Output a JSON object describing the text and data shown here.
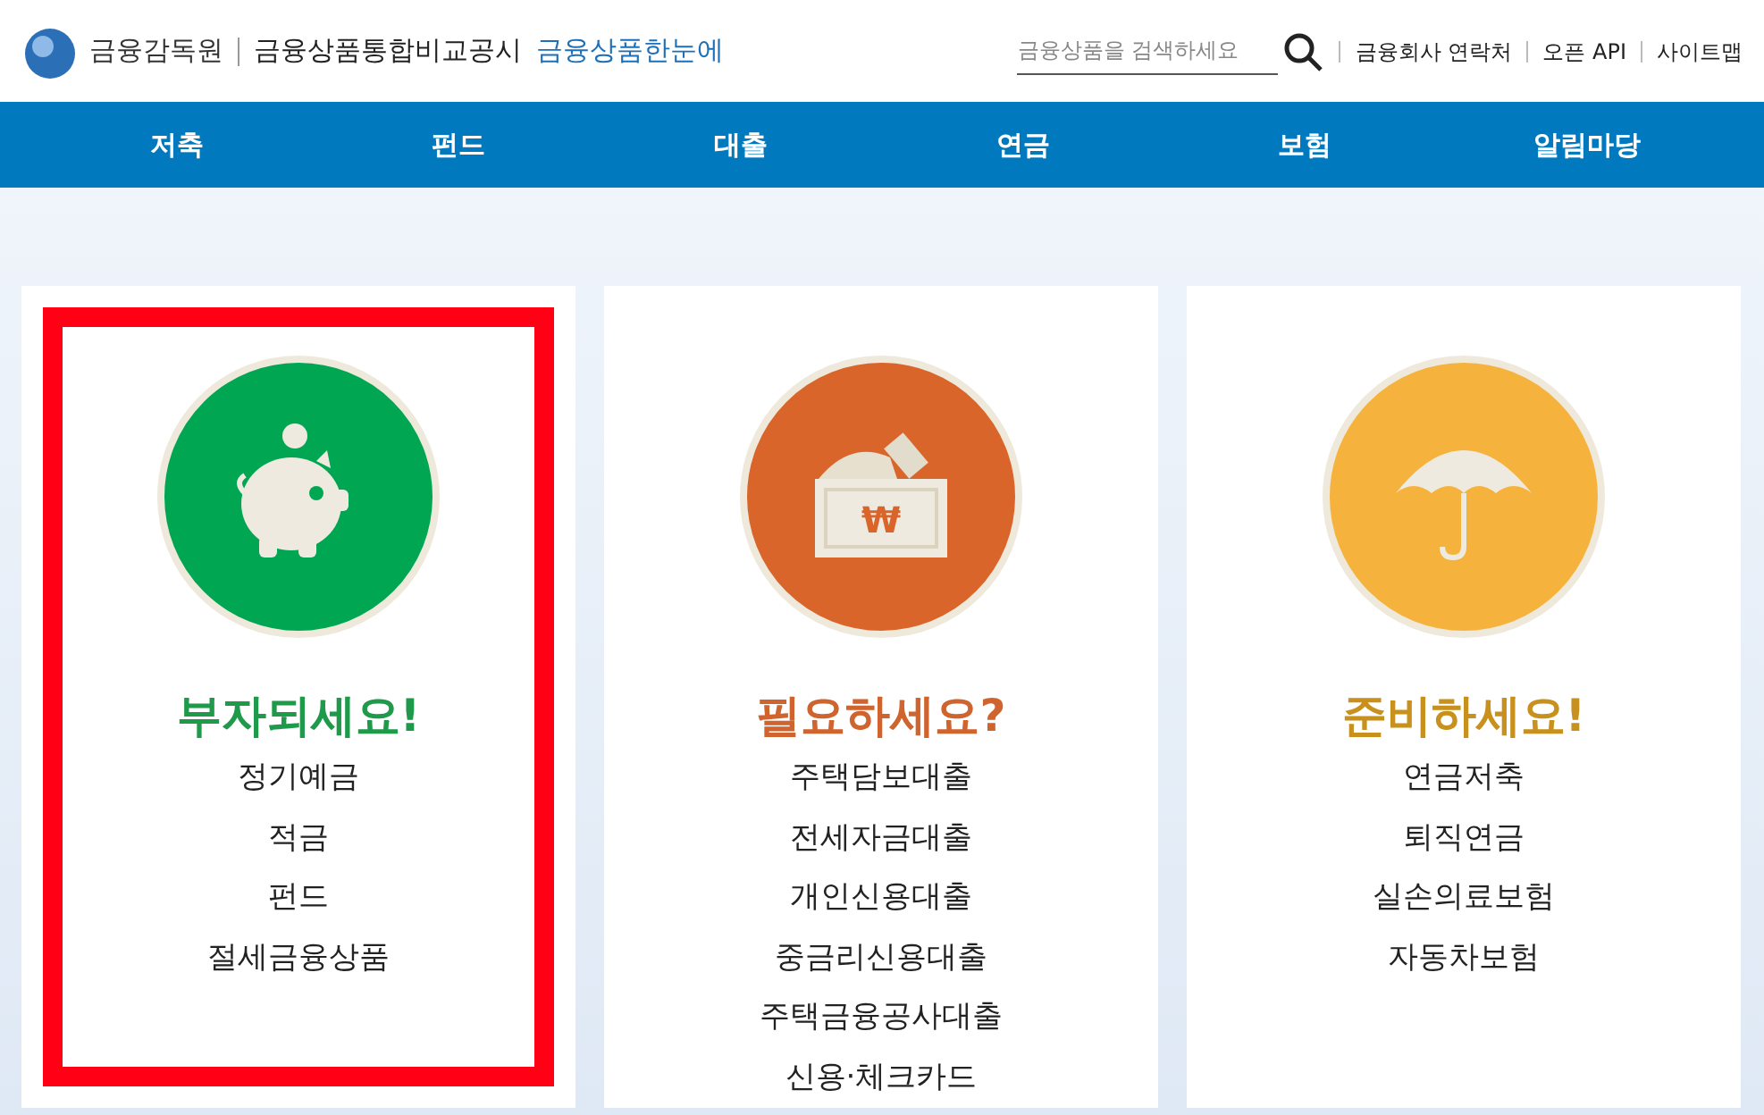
{
  "header": {
    "org": "금융감독원",
    "service": "금융상품통합비교공시",
    "brand": "금융상품한눈에",
    "search": {
      "placeholder": "금융상품을 검색하세요"
    },
    "links": [
      "금융회사 연락처",
      "오픈 API",
      "사이트맵"
    ]
  },
  "nav": [
    "저축",
    "펀드",
    "대출",
    "연금",
    "보험",
    "알림마당"
  ],
  "cards": [
    {
      "kind": "piggy",
      "color": "#00a651",
      "title": "부자되세요!",
      "highlighted": true,
      "items": [
        "정기예금",
        "적금",
        "펀드",
        "절세금융상품"
      ]
    },
    {
      "kind": "wallet",
      "icon_label": "₩",
      "color": "#d9652a",
      "title": "필요하세요?",
      "highlighted": false,
      "items": [
        "주택담보대출",
        "전세자금대출",
        "개인신용대출",
        "중금리신용대출",
        "주택금융공사대출",
        "신용·체크카드"
      ]
    },
    {
      "kind": "umbrella",
      "color": "#f5b33e",
      "title": "준비하세요!",
      "highlighted": false,
      "items": [
        "연금저축",
        "퇴직연금",
        "실손의료보험",
        "자동차보험"
      ]
    }
  ]
}
